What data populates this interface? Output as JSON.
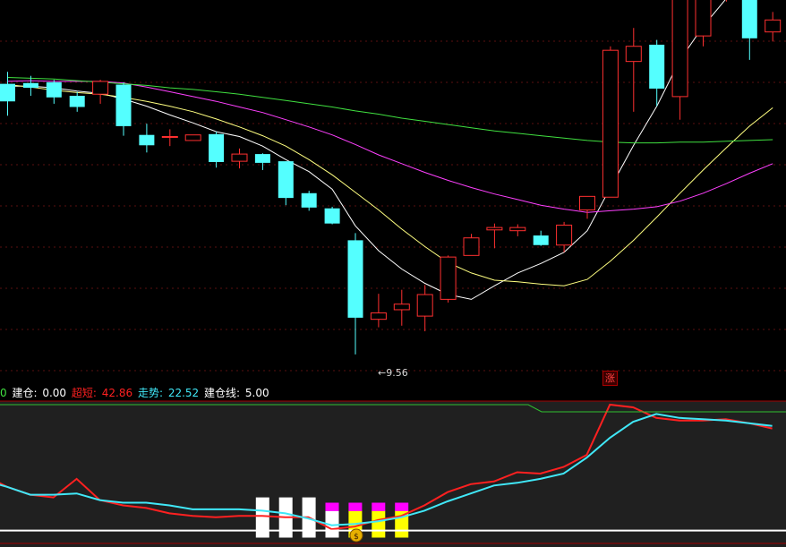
{
  "legend": {
    "prefix": "0",
    "jiancang_label": "建仓:",
    "jiancang_value": "0.00",
    "chaoduan_label": "超短:",
    "chaoduan_value": "42.86",
    "zoushi_label": "走势:",
    "zoushi_value": "22.52",
    "jcx_label": "建仓线:",
    "jcx_value": "5.00"
  },
  "low_marker": "9.56",
  "signal_label": "涨",
  "colors": {
    "up": "#ff3030",
    "down": "#54ffff",
    "ma_white": "#ffffff",
    "ma_yellow": "#ffff80",
    "ma_magenta": "#ff40ff",
    "ma_green": "#40e040",
    "chaoduan": "#ff2020",
    "zoushi": "#40e8f8",
    "jiancang_line": "#ffffff",
    "bar_white": "#ffffff",
    "bar_yellow": "#ffff00",
    "bar_magenta": "#ff00ff"
  },
  "chart_data": [
    {
      "type": "candlestick",
      "title": "",
      "ylim": [
        9.2,
        14.0
      ],
      "candles": [
        {
          "o": 12.95,
          "h": 13.1,
          "l": 12.55,
          "c": 12.73
        },
        {
          "o": 12.96,
          "h": 13.05,
          "l": 12.8,
          "c": 12.9
        },
        {
          "o": 12.97,
          "h": 13.0,
          "l": 12.7,
          "c": 12.78
        },
        {
          "o": 12.8,
          "h": 12.85,
          "l": 12.6,
          "c": 12.66
        },
        {
          "o": 12.82,
          "h": 13.0,
          "l": 12.7,
          "c": 12.98
        },
        {
          "o": 12.94,
          "h": 12.97,
          "l": 12.3,
          "c": 12.42
        },
        {
          "o": 12.31,
          "h": 12.45,
          "l": 12.09,
          "c": 12.18
        },
        {
          "o": 12.29,
          "h": 12.38,
          "l": 12.17,
          "c": 12.29
        },
        {
          "o": 12.24,
          "h": 12.31,
          "l": 12.24,
          "c": 12.31
        },
        {
          "o": 12.32,
          "h": 12.35,
          "l": 11.9,
          "c": 11.97
        },
        {
          "o": 11.98,
          "h": 12.14,
          "l": 11.89,
          "c": 12.07
        },
        {
          "o": 12.07,
          "h": 12.08,
          "l": 11.87,
          "c": 11.96
        },
        {
          "o": 11.98,
          "h": 11.98,
          "l": 11.43,
          "c": 11.52
        },
        {
          "o": 11.58,
          "h": 11.61,
          "l": 11.36,
          "c": 11.4
        },
        {
          "o": 11.39,
          "h": 11.41,
          "l": 11.19,
          "c": 11.2
        },
        {
          "o": 10.99,
          "h": 11.08,
          "l": 9.56,
          "c": 10.02
        },
        {
          "o": 10.0,
          "h": 10.32,
          "l": 9.9,
          "c": 10.08
        },
        {
          "o": 10.12,
          "h": 10.37,
          "l": 9.92,
          "c": 10.19
        },
        {
          "o": 10.04,
          "h": 10.43,
          "l": 9.85,
          "c": 10.31
        },
        {
          "o": 10.25,
          "h": 10.8,
          "l": 10.21,
          "c": 10.78
        },
        {
          "o": 10.8,
          "h": 11.07,
          "l": 10.8,
          "c": 11.02
        },
        {
          "o": 11.12,
          "h": 11.2,
          "l": 10.89,
          "c": 11.15
        },
        {
          "o": 11.11,
          "h": 11.19,
          "l": 11.04,
          "c": 11.15
        },
        {
          "o": 11.05,
          "h": 11.11,
          "l": 10.92,
          "c": 10.93
        },
        {
          "o": 10.93,
          "h": 11.22,
          "l": 10.84,
          "c": 11.18
        },
        {
          "o": 11.37,
          "h": 11.54,
          "l": 11.26,
          "c": 11.54
        },
        {
          "o": 11.53,
          "h": 13.42,
          "l": 11.53,
          "c": 13.37
        },
        {
          "o": 13.23,
          "h": 13.65,
          "l": 12.6,
          "c": 13.42
        },
        {
          "o": 13.44,
          "h": 13.5,
          "l": 12.67,
          "c": 12.89
        },
        {
          "o": 12.79,
          "h": 14.3,
          "l": 12.5,
          "c": 14.2
        },
        {
          "o": 13.55,
          "h": 14.3,
          "l": 13.42,
          "c": 14.15
        },
        {
          "o": 14.15,
          "h": 14.3,
          "l": 13.98,
          "c": 14.3
        },
        {
          "o": 14.1,
          "h": 14.2,
          "l": 13.25,
          "c": 13.52
        },
        {
          "o": 13.6,
          "h": 13.85,
          "l": 13.48,
          "c": 13.75
        }
      ],
      "moving_averages": [
        {
          "color": "ma_white",
          "values": [
            12.92,
            12.92,
            12.9,
            12.86,
            12.83,
            12.76,
            12.67,
            12.56,
            12.46,
            12.35,
            12.29,
            12.17,
            12.0,
            11.85,
            11.63,
            11.17,
            10.86,
            10.63,
            10.45,
            10.31,
            10.25,
            10.42,
            10.58,
            10.7,
            10.84,
            11.11,
            11.65,
            12.18,
            12.67,
            13.25,
            13.67,
            14.02,
            14.28,
            14.5
          ]
        },
        {
          "color": "ma_yellow",
          "values": [
            12.94,
            12.91,
            12.87,
            12.84,
            12.82,
            12.78,
            12.73,
            12.67,
            12.6,
            12.51,
            12.41,
            12.3,
            12.17,
            12.0,
            11.81,
            11.59,
            11.37,
            11.13,
            10.91,
            10.71,
            10.58,
            10.49,
            10.47,
            10.44,
            10.42,
            10.5,
            10.73,
            10.99,
            11.28,
            11.58,
            11.87,
            12.15,
            12.42,
            12.65
          ]
        },
        {
          "color": "ma_magenta",
          "values": [
            12.98,
            12.99,
            12.98,
            12.98,
            12.98,
            12.96,
            12.91,
            12.85,
            12.79,
            12.73,
            12.66,
            12.59,
            12.5,
            12.41,
            12.31,
            12.19,
            12.06,
            11.95,
            11.84,
            11.74,
            11.65,
            11.57,
            11.5,
            11.43,
            11.38,
            11.34,
            11.36,
            11.38,
            11.41,
            11.48,
            11.58,
            11.7,
            11.83,
            11.95
          ]
        },
        {
          "color": "ma_green",
          "values": [
            13.03,
            13.02,
            13.01,
            12.99,
            12.97,
            12.95,
            12.93,
            12.9,
            12.88,
            12.85,
            12.82,
            12.78,
            12.74,
            12.7,
            12.66,
            12.61,
            12.57,
            12.52,
            12.48,
            12.44,
            12.4,
            12.36,
            12.33,
            12.3,
            12.27,
            12.24,
            12.22,
            12.21,
            12.21,
            12.22,
            12.22,
            12.23,
            12.24,
            12.25
          ]
        }
      ]
    },
    {
      "type": "line",
      "title": "",
      "ylim": [
        0,
        100
      ],
      "reference_lines": [
        5
      ],
      "series": [
        {
          "name": "超短",
          "color": "chaoduan",
          "values": [
            47,
            38,
            32,
            30,
            44,
            28,
            24,
            22,
            18,
            16,
            15,
            16,
            16,
            15,
            15,
            6,
            8,
            13,
            16,
            24,
            34,
            40,
            42,
            49,
            48,
            53,
            62,
            100,
            98,
            90,
            88,
            88,
            89,
            86,
            82
          ]
        },
        {
          "name": "走势",
          "color": "zoushi",
          "values": [
            43,
            38,
            32,
            32,
            33,
            28,
            26,
            26,
            24,
            21,
            21,
            21,
            20,
            18,
            14,
            9,
            10,
            12,
            15,
            20,
            27,
            33,
            39,
            41,
            44,
            48,
            60,
            75,
            87,
            93,
            90,
            89,
            88,
            86,
            84
          ]
        }
      ],
      "bars": [
        {
          "index": 12,
          "layers": [
            {
              "color": "bar_white",
              "value": 30
            }
          ]
        },
        {
          "index": 13,
          "layers": [
            {
              "color": "bar_white",
              "value": 30
            }
          ]
        },
        {
          "index": 14,
          "layers": [
            {
              "color": "bar_white",
              "value": 30
            }
          ]
        },
        {
          "index": 15,
          "layers": [
            {
              "color": "bar_white",
              "value": 20
            },
            {
              "color": "bar_magenta",
              "value": 6
            }
          ]
        },
        {
          "index": 16,
          "layers": [
            {
              "color": "bar_yellow",
              "value": 20
            },
            {
              "color": "bar_magenta",
              "value": 6
            }
          ]
        },
        {
          "index": 17,
          "layers": [
            {
              "color": "bar_yellow",
              "value": 20
            },
            {
              "color": "bar_magenta",
              "value": 6
            }
          ]
        },
        {
          "index": 18,
          "layers": [
            {
              "color": "bar_yellow",
              "value": 20
            },
            {
              "color": "bar_magenta",
              "value": 6
            }
          ]
        }
      ]
    }
  ]
}
